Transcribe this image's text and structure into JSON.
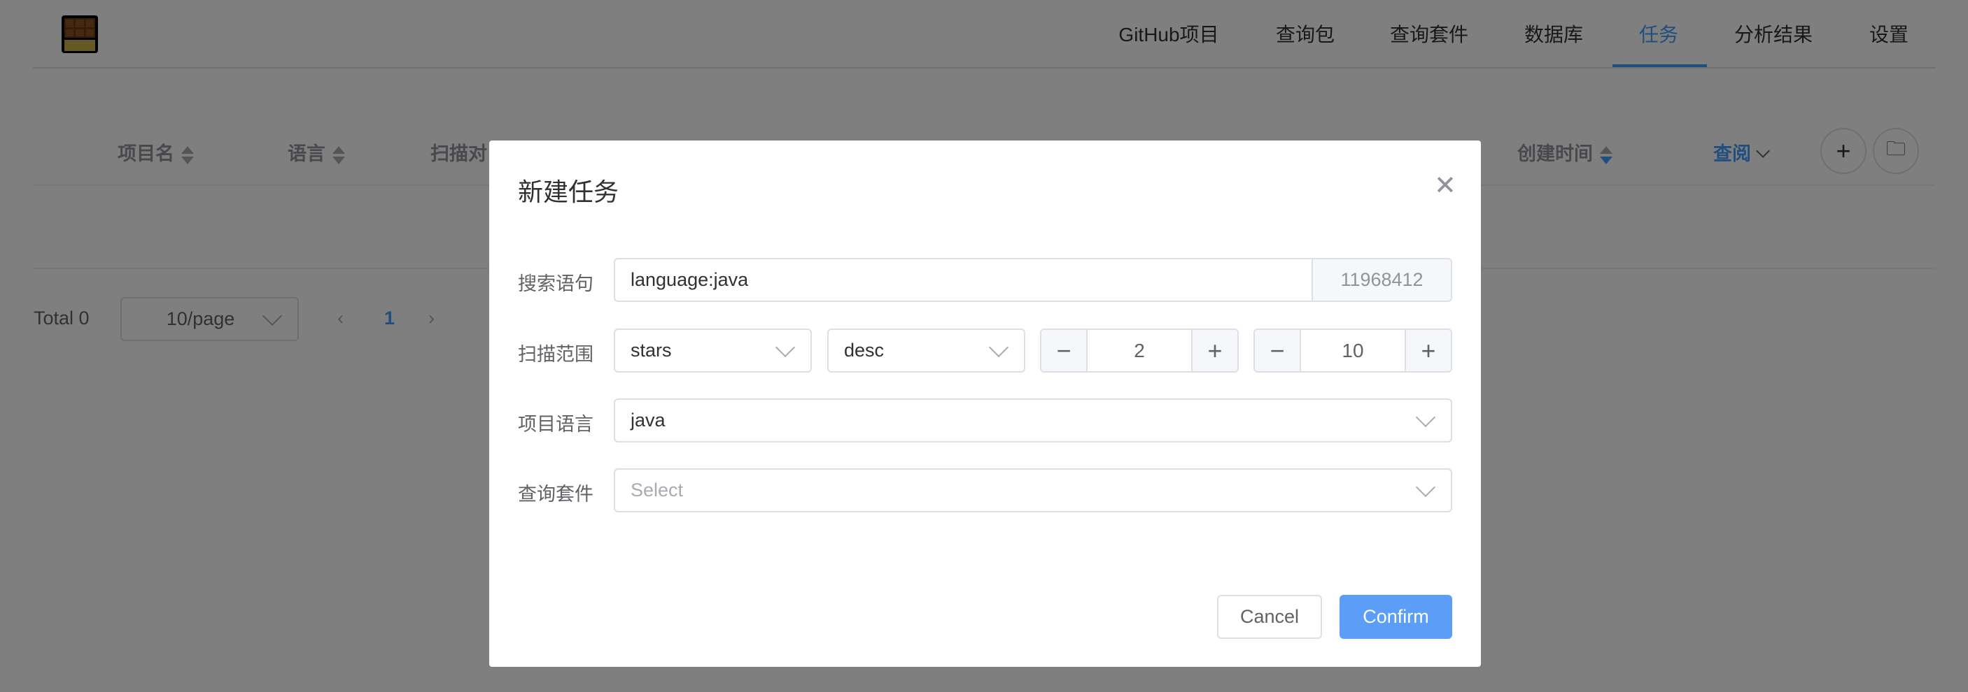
{
  "nav": {
    "items": [
      "GitHub项目",
      "查询包",
      "查询套件",
      "数据库",
      "任务",
      "分析结果",
      "设置"
    ],
    "active": "任务"
  },
  "table": {
    "columns": [
      "项目名",
      "语言",
      "扫描对",
      "创建时间"
    ],
    "view_label": "查阅"
  },
  "pagination": {
    "total": "Total 0",
    "page_size": "10/page",
    "current_page": "1"
  },
  "dialog": {
    "title": "新建任务",
    "search_label": "搜索语句",
    "search_value": "language:java",
    "search_count": "11968412",
    "range_label": "扫描范围",
    "sort_field": "stars",
    "sort_order": "desc",
    "page_start": "2",
    "page_count": "10",
    "language_label": "项目语言",
    "language_value": "java",
    "suite_label": "查询套件",
    "suite_placeholder": "Select",
    "cancel": "Cancel",
    "confirm": "Confirm"
  },
  "colors": {
    "primary": "#409eff",
    "confirm": "#5c9df8"
  }
}
